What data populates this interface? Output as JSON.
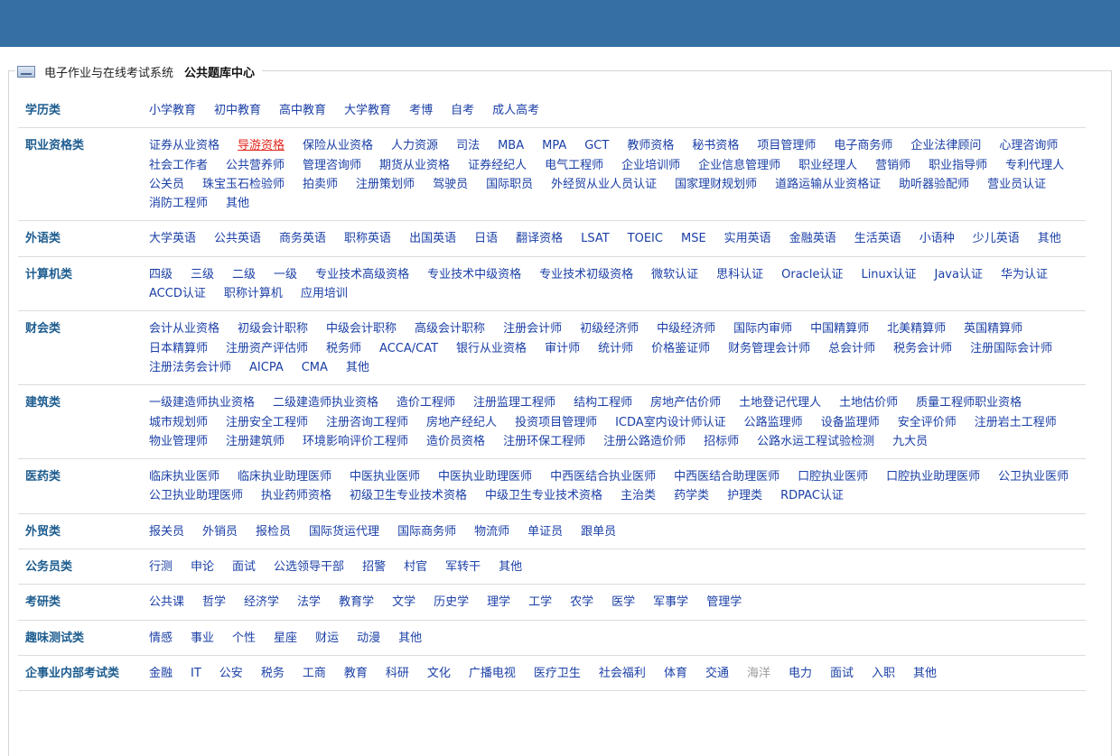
{
  "breadcrumb": {
    "root": "电子作业与在线考试系统",
    "current": "公共题库中心"
  },
  "categories": [
    {
      "name": "学历类",
      "links": [
        "小学教育",
        "初中教育",
        "高中教育",
        "大学教育",
        "考博",
        "自考",
        "成人高考"
      ]
    },
    {
      "name": "职业资格类",
      "links": [
        "证券从业资格",
        "导游资格",
        "保险从业资格",
        "人力资源",
        "司法",
        "MBA",
        "MPA",
        "GCT",
        "教师资格",
        "秘书资格",
        "项目管理师",
        "电子商务师",
        "企业法律顾问",
        "心理咨询师",
        "社会工作者",
        "公共营养师",
        "管理咨询师",
        "期货从业资格",
        "证券经纪人",
        "电气工程师",
        "企业培训师",
        "企业信息管理师",
        "职业经理人",
        "营销师",
        "职业指导师",
        "专利代理人",
        "公关员",
        "珠宝玉石检验师",
        "拍卖师",
        "注册策划师",
        "驾驶员",
        "国际职员",
        "外经贸从业人员认证",
        "国家理财规划师",
        "道路运输从业资格证",
        "助听器验配师",
        "营业员认证",
        "消防工程师",
        "其他"
      ],
      "highlight": 1
    },
    {
      "name": "外语类",
      "links": [
        "大学英语",
        "公共英语",
        "商务英语",
        "职称英语",
        "出国英语",
        "日语",
        "翻译资格",
        "LSAT",
        "TOEIC",
        "MSE",
        "实用英语",
        "金融英语",
        "生活英语",
        "小语种",
        "少儿英语",
        "其他"
      ]
    },
    {
      "name": "计算机类",
      "links": [
        "四级",
        "三级",
        "二级",
        "一级",
        "专业技术高级资格",
        "专业技术中级资格",
        "专业技术初级资格",
        "微软认证",
        "思科认证",
        "Oracle认证",
        "Linux认证",
        "Java认证",
        "华为认证",
        "ACCD认证",
        "职称计算机",
        "应用培训"
      ]
    },
    {
      "name": "财会类",
      "links": [
        "会计从业资格",
        "初级会计职称",
        "中级会计职称",
        "高级会计职称",
        "注册会计师",
        "初级经济师",
        "中级经济师",
        "国际内审师",
        "中国精算师",
        "北美精算师",
        "英国精算师",
        "日本精算师",
        "注册资产评估师",
        "税务师",
        "ACCA/CAT",
        "银行从业资格",
        "审计师",
        "统计师",
        "价格鉴证师",
        "财务管理会计师",
        "总会计师",
        "税务会计师",
        "注册国际会计师",
        "注册法务会计师",
        "AICPA",
        "CMA",
        "其他"
      ]
    },
    {
      "name": "建筑类",
      "links": [
        "一级建造师执业资格",
        "二级建造师执业资格",
        "造价工程师",
        "注册监理工程师",
        "结构工程师",
        "房地产估价师",
        "土地登记代理人",
        "土地估价师",
        "质量工程师职业资格",
        "城市规划师",
        "注册安全工程师",
        "注册咨询工程师",
        "房地产经纪人",
        "投资项目管理师",
        "ICDA室内设计师认证",
        "公路监理师",
        "设备监理师",
        "安全评价师",
        "注册岩土工程师",
        "物业管理师",
        "注册建筑师",
        "环境影响评价工程师",
        "造价员资格",
        "注册环保工程师",
        "注册公路造价师",
        "招标师",
        "公路水运工程试验检测",
        "九大员"
      ]
    },
    {
      "name": "医药类",
      "links": [
        "临床执业医师",
        "临床执业助理医师",
        "中医执业医师",
        "中医执业助理医师",
        "中西医结合执业医师",
        "中西医结合助理医师",
        "口腔执业医师",
        "口腔执业助理医师",
        "公卫执业医师",
        "公卫执业助理医师",
        "执业药师资格",
        "初级卫生专业技术资格",
        "中级卫生专业技术资格",
        "主治类",
        "药学类",
        "护理类",
        "RDPAC认证"
      ]
    },
    {
      "name": "外贸类",
      "links": [
        "报关员",
        "外销员",
        "报检员",
        "国际货运代理",
        "国际商务师",
        "物流师",
        "单证员",
        "跟单员"
      ]
    },
    {
      "name": "公务员类",
      "links": [
        "行测",
        "申论",
        "面试",
        "公选领导干部",
        "招警",
        "村官",
        "军转干",
        "其他"
      ]
    },
    {
      "name": "考研类",
      "links": [
        "公共课",
        "哲学",
        "经济学",
        "法学",
        "教育学",
        "文学",
        "历史学",
        "理学",
        "工学",
        "农学",
        "医学",
        "军事学",
        "管理学"
      ]
    },
    {
      "name": "趣味测试类",
      "links": [
        "情感",
        "事业",
        "个性",
        "星座",
        "财运",
        "动漫",
        "其他"
      ]
    },
    {
      "name": "企事业内部考试类",
      "links": [
        "金融",
        "IT",
        "公安",
        "税务",
        "工商",
        "教育",
        "科研",
        "文化",
        "广播电视",
        "医疗卫生",
        "社会福利",
        "体育",
        "交通",
        "海洋",
        "电力",
        "面试",
        "入职",
        "其他"
      ],
      "muted": 13
    }
  ],
  "colors": {
    "topbar": "#356fa4",
    "category": "#1d5c8f",
    "link": "#1a3fa6",
    "highlight": "#e0251b",
    "muted": "#9a9a9a"
  }
}
